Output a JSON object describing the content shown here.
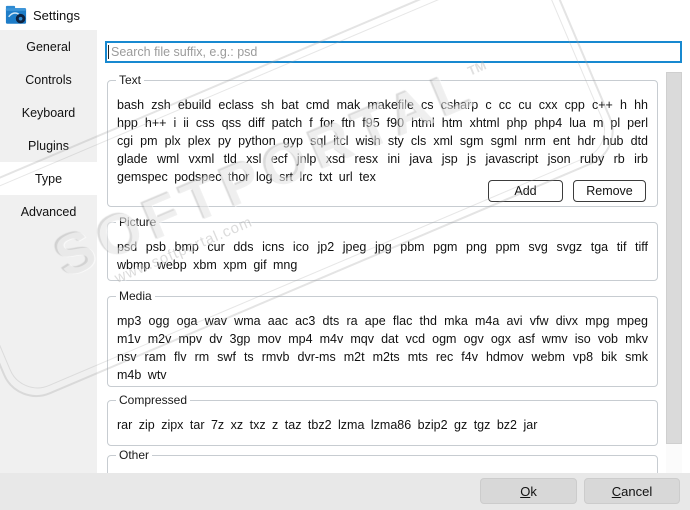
{
  "window": {
    "title": "Settings"
  },
  "sidebar": {
    "items": [
      "General",
      "Controls",
      "Keyboard",
      "Plugins",
      "Type",
      "Advanced"
    ],
    "selected": "Type"
  },
  "search": {
    "placeholder": "Search file suffix, e.g.: psd",
    "value": ""
  },
  "sections": {
    "text": {
      "title": "Text",
      "suffixes": "bash zsh ebuild eclass sh bat cmd mak makefile cs csharp c cc cu cxx cpp c++ h hh hpp h++ i ii css qss diff patch f for ftn f95 f90 html htm xhtml php php4 lua m pl perl cgi pm plx plex py python gyp sql itcl wish sty cls xml sgm sgml nrm ent hdr hub dtd glade wml vxml tld xsl ecf jnlp xsd resx ini java jsp js javascript json ruby rb irb gemspec podspec thor log srt lrc txt url tex",
      "add_label": "Add",
      "remove_label": "Remove"
    },
    "picture": {
      "title": "Picture",
      "suffixes": "psd psb bmp cur dds icns ico jp2 jpeg jpg pbm pgm png ppm svg svgz tga tif tiff wbmp webp xbm xpm gif mng"
    },
    "media": {
      "title": "Media",
      "suffixes": "mp3 ogg oga wav wma aac ac3 dts ra ape flac thd mka m4a avi vfw divx mpg mpeg m1v m2v mpv dv 3gp mov mp4 m4v mqv dat vcd ogm ogv ogx asf wmv iso vob mkv nsv ram flv rm swf ts rmvb dvr-ms m2t m2ts mts rec f4v hdmov webm vp8 bik smk m4b wtv"
    },
    "compressed": {
      "title": "Compressed",
      "suffixes": "rar zip zipx tar 7z xz txz z taz tbz2 lzma lzma86 bzip2 gz tgz bz2 jar"
    },
    "other": {
      "title": "Other",
      "suffixes": ""
    }
  },
  "footer": {
    "ok_label": "Ok",
    "cancel_label": "Cancel"
  },
  "watermark": {
    "brand": "SOFTPORTAL",
    "tm": "TM",
    "url": "www.softportal.com"
  },
  "colors": {
    "accent_blue": "#1889d0",
    "sidebar_bg": "#f0f0f0",
    "footer_bg": "#e8e8e8",
    "groupbox_border": "#c7ccd1",
    "icon_blue": "#1e7dc8",
    "icon_dark": "#0e2240"
  }
}
